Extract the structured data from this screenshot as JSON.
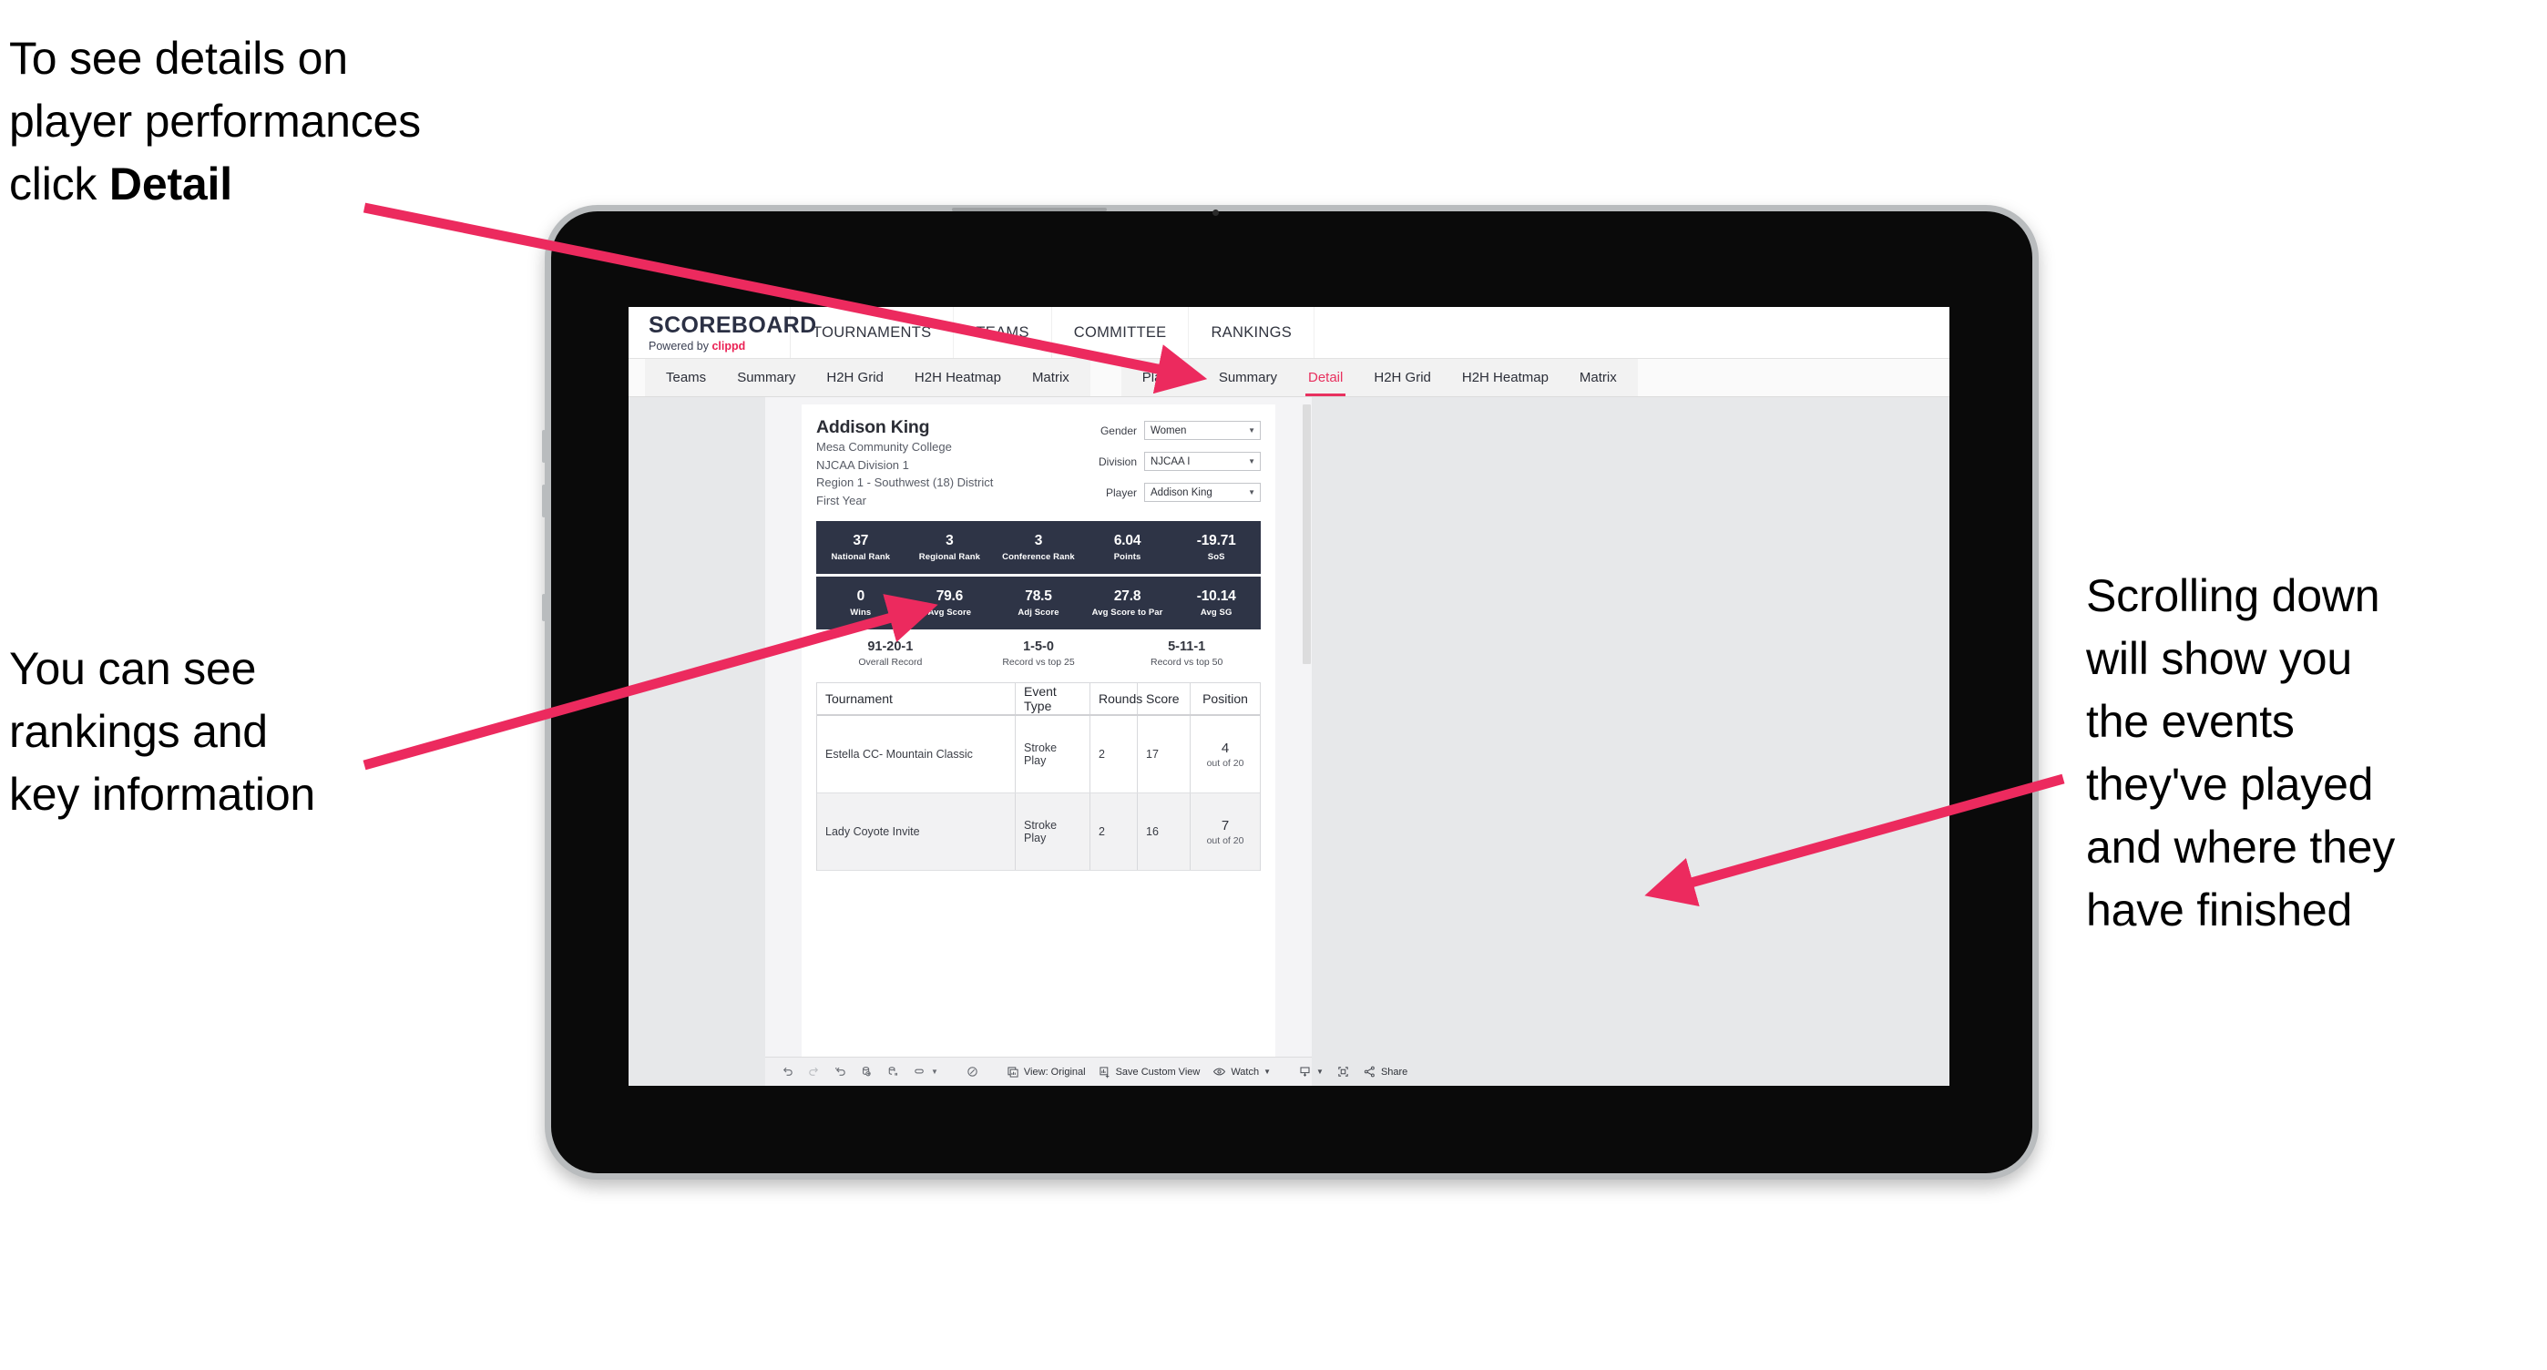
{
  "annotations": {
    "detail": "To see details on\nplayer performances\nclick ",
    "detail_bold": "Detail",
    "rankings": "You can see\nrankings and\nkey information",
    "scrolling": "Scrolling down\nwill show you\nthe events\nthey've played\nand where they\nhave finished"
  },
  "colors": {
    "accent_pink": "#e8315f",
    "arrow_pink": "#ec2a5e",
    "stat_band": "#2e3446",
    "brand_red": "#eb2154",
    "canvas": "#e7e8ea"
  },
  "app": {
    "logo": {
      "title": "SCOREBOARD",
      "powered_prefix": "Powered by ",
      "powered_brand": "clippd"
    },
    "top_nav": [
      "TOURNAMENTS",
      "TEAMS",
      "COMMITTEE",
      "RANKINGS"
    ],
    "tab_group_teams": [
      "Teams",
      "Summary",
      "H2H Grid",
      "H2H Heatmap",
      "Matrix"
    ],
    "tab_group_players": [
      "Players",
      "Summary",
      "Detail",
      "H2H Grid",
      "H2H Heatmap",
      "Matrix"
    ],
    "active_tab": "Detail"
  },
  "player": {
    "name": "Addison King",
    "school": "Mesa Community College",
    "division": "NJCAA Division 1",
    "region": "Region 1 - Southwest (18) District",
    "year": "First Year"
  },
  "filters": [
    {
      "label": "Gender",
      "value": "Women"
    },
    {
      "label": "Division",
      "value": "NJCAA I"
    },
    {
      "label": "Player",
      "value": "Addison King"
    }
  ],
  "stats_primary": [
    {
      "value": "37",
      "label": "National Rank"
    },
    {
      "value": "3",
      "label": "Regional Rank"
    },
    {
      "value": "3",
      "label": "Conference Rank"
    },
    {
      "value": "6.04",
      "label": "Points"
    },
    {
      "value": "-19.71",
      "label": "SoS"
    }
  ],
  "stats_secondary": [
    {
      "value": "0",
      "label": "Wins"
    },
    {
      "value": "79.6",
      "label": "Avg Score"
    },
    {
      "value": "78.5",
      "label": "Adj Score"
    },
    {
      "value": "27.8",
      "label": "Avg Score to Par"
    },
    {
      "value": "-10.14",
      "label": "Avg SG"
    }
  ],
  "records": [
    {
      "value": "91-20-1",
      "label": "Overall Record"
    },
    {
      "value": "1-5-0",
      "label": "Record vs top 25"
    },
    {
      "value": "5-11-1",
      "label": "Record vs top 50"
    }
  ],
  "events_table": {
    "columns": [
      "Tournament",
      "Event Type",
      "Rounds",
      "Score",
      "Position"
    ],
    "rows": [
      {
        "tournament": "Estella CC- Mountain Classic",
        "event_type": "Stroke Play",
        "rounds": "2",
        "score": "17",
        "position": "4",
        "position_of": "out of 20"
      },
      {
        "tournament": "Lady Coyote Invite",
        "event_type": "Stroke Play",
        "rounds": "2",
        "score": "16",
        "position": "7",
        "position_of": "out of 20"
      }
    ]
  },
  "toolbar": {
    "view_label": "View: Original",
    "save_label": "Save Custom View",
    "watch_label": "Watch",
    "share_label": "Share"
  }
}
